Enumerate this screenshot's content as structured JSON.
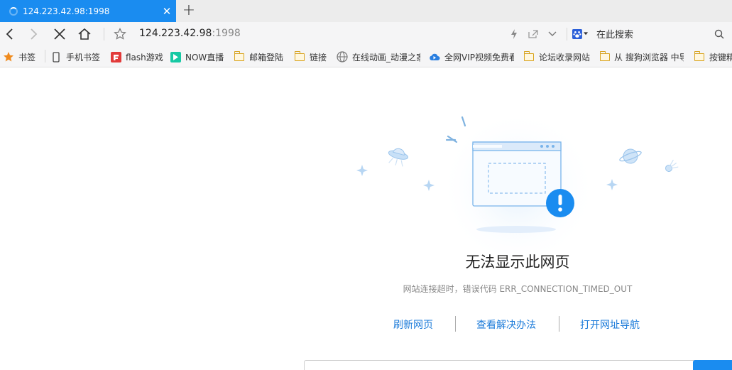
{
  "tab": {
    "title": "124.223.42.98:1998",
    "close": "✕",
    "new_tab": "+"
  },
  "address": {
    "host": "124.223.42.98",
    "port": ":1998"
  },
  "search": {
    "text": "在此搜索"
  },
  "bookmarks": [
    {
      "label": "书签",
      "icon": "star-icon"
    },
    {
      "label": "手机书签",
      "icon": "phone-icon"
    },
    {
      "label": "flash游戏",
      "icon": "flash-game-icon"
    },
    {
      "label": "NOW直播",
      "icon": "now-live-icon"
    },
    {
      "label": "邮箱登陆",
      "icon": "folder-icon"
    },
    {
      "label": "链接",
      "icon": "folder-icon"
    },
    {
      "label": "在线动画_动漫之家",
      "icon": "globe-icon"
    },
    {
      "label": "全网VIP视频免费看",
      "icon": "cloud-icon"
    },
    {
      "label": "论坛收录网站",
      "icon": "folder-icon"
    },
    {
      "label": "从 搜狗浏览器 中导入",
      "icon": "folder-icon"
    },
    {
      "label": "按键精灵",
      "icon": "folder-icon"
    }
  ],
  "error": {
    "title": "无法显示此网页",
    "subtitle": "网站连接超时，错误代码 ERR_CONNECTION_TIMED_OUT"
  },
  "actions": {
    "refresh": "刷新网页",
    "solutions": "查看解决办法",
    "open_nav": "打开网址导航"
  },
  "colors": {
    "accent": "#1a8cf0",
    "link": "#1a7ad9"
  }
}
